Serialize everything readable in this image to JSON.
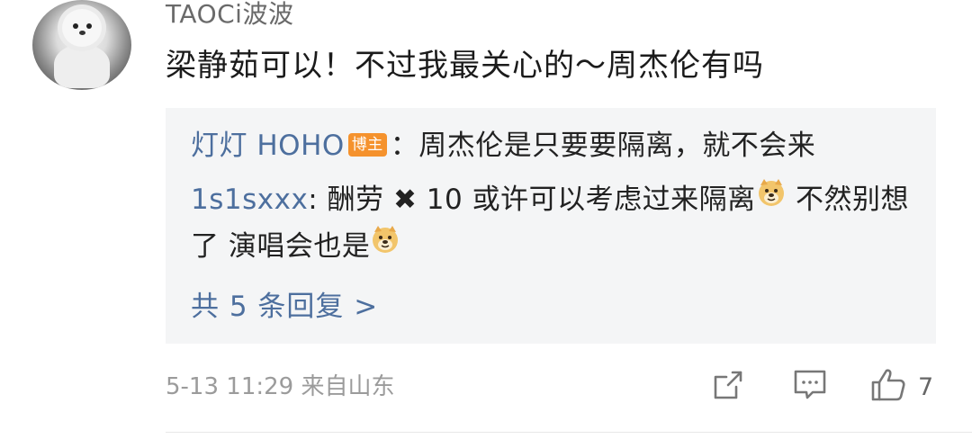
{
  "comment": {
    "username": "TAOCi波波",
    "text": "梁静茹可以！不过我最关心的～周杰伦有吗",
    "timestamp": "5-13 11:29",
    "location": "来自山东",
    "like_count": "7"
  },
  "replies": [
    {
      "name": "灯灯 HOHO",
      "badge": "博主",
      "separator": "：",
      "text": "周杰伦是只要要隔离，就不会来"
    },
    {
      "name": "1s1sxxx",
      "separator": ": ",
      "text_part1": "酬劳 ✖ 10 或许可以考虑过来隔离",
      "text_part2": " 不然别想了  演唱会也是"
    }
  ],
  "more_replies_label": "共 5 条回复 >",
  "icons": {
    "share": "share-icon",
    "comment": "comment-icon",
    "like": "thumbs-up-icon",
    "emoji": "doge-emoji-icon"
  },
  "colors": {
    "link": "#4d6f9e",
    "badge": "#f5922d",
    "reply_bg": "#f4f5f6"
  }
}
